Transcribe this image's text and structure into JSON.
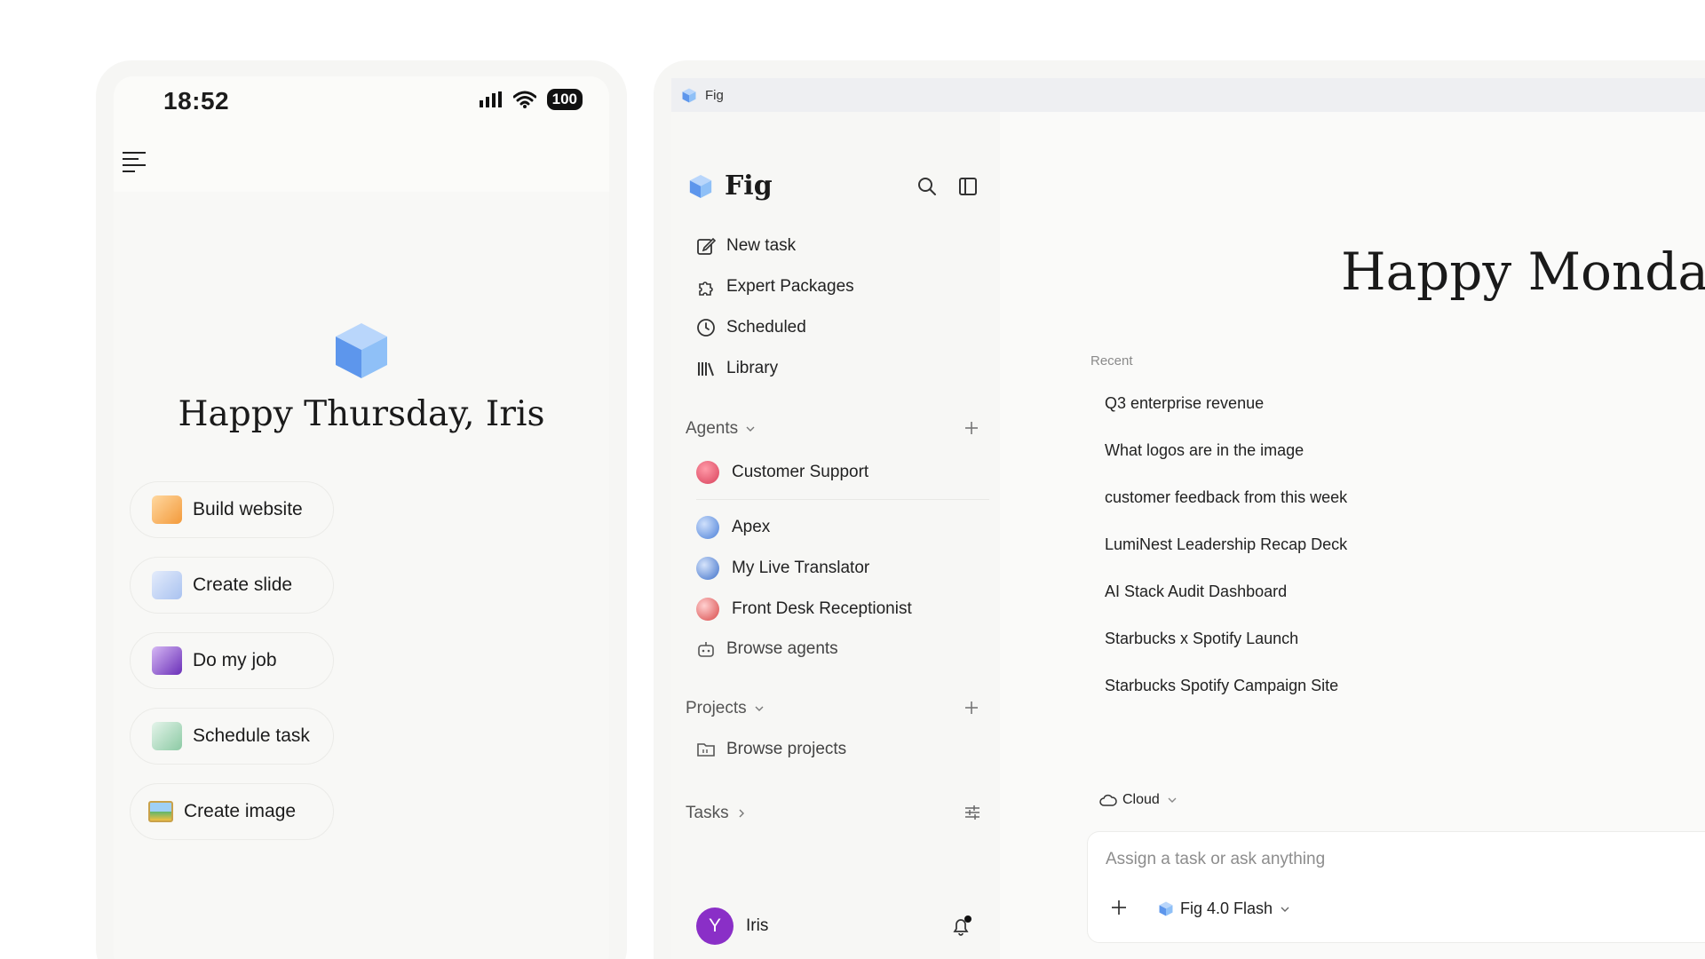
{
  "phone": {
    "status_time": "18:52",
    "battery": "100",
    "greeting": "Happy Thursday, Iris",
    "quick_actions": [
      {
        "label": "Build website",
        "icon": "website-icon",
        "color": "#f5a94e"
      },
      {
        "label": "Create slide",
        "icon": "slide-icon",
        "color": "#b9cdf3"
      },
      {
        "label": "Do my job",
        "icon": "job-icon",
        "color": "#7c3fc4"
      },
      {
        "label": "Schedule task",
        "icon": "schedule-icon",
        "color": "#9fd4b4"
      },
      {
        "label": "Create image",
        "icon": "image-icon",
        "color": "#6bbf7a"
      }
    ]
  },
  "window": {
    "title": "Fig"
  },
  "sidebar": {
    "brand": "Fig",
    "nav": [
      {
        "label": "New task",
        "icon": "edit-icon"
      },
      {
        "label": "Expert Packages",
        "icon": "puzzle-icon"
      },
      {
        "label": "Scheduled",
        "icon": "clock-icon"
      },
      {
        "label": "Library",
        "icon": "library-icon"
      }
    ],
    "agents_heading": "Agents",
    "agents": [
      {
        "label": "Customer Support",
        "color": "#e0566b"
      },
      {
        "label": "Apex",
        "color": "#5d8de0"
      },
      {
        "label": "My Live Translator",
        "color": "#4f7fd6"
      },
      {
        "label": "Front Desk Receptionist",
        "color": "#e05a5a"
      }
    ],
    "browse_agents": "Browse agents",
    "projects_heading": "Projects",
    "browse_projects": "Browse projects",
    "tasks_heading": "Tasks",
    "user_initial": "Y",
    "user_name": "Iris"
  },
  "main": {
    "greeting": "Happy Monday,",
    "recent_label": "Recent",
    "recent": [
      "Q3 enterprise revenue",
      "What logos are in the image",
      "customer feedback from this week",
      "LumiNest Leadership Recap Deck",
      "AI Stack Audit Dashboard",
      "Starbucks x Spotify Launch",
      "Starbucks Spotify Campaign Site"
    ],
    "mode": "Cloud",
    "composer_placeholder": "Assign a task or ask anything",
    "model": "Fig 4.0 Flash"
  },
  "colors": {
    "accent_purple": "#8a2fc7",
    "cube_blue": "#6aa6f2"
  }
}
